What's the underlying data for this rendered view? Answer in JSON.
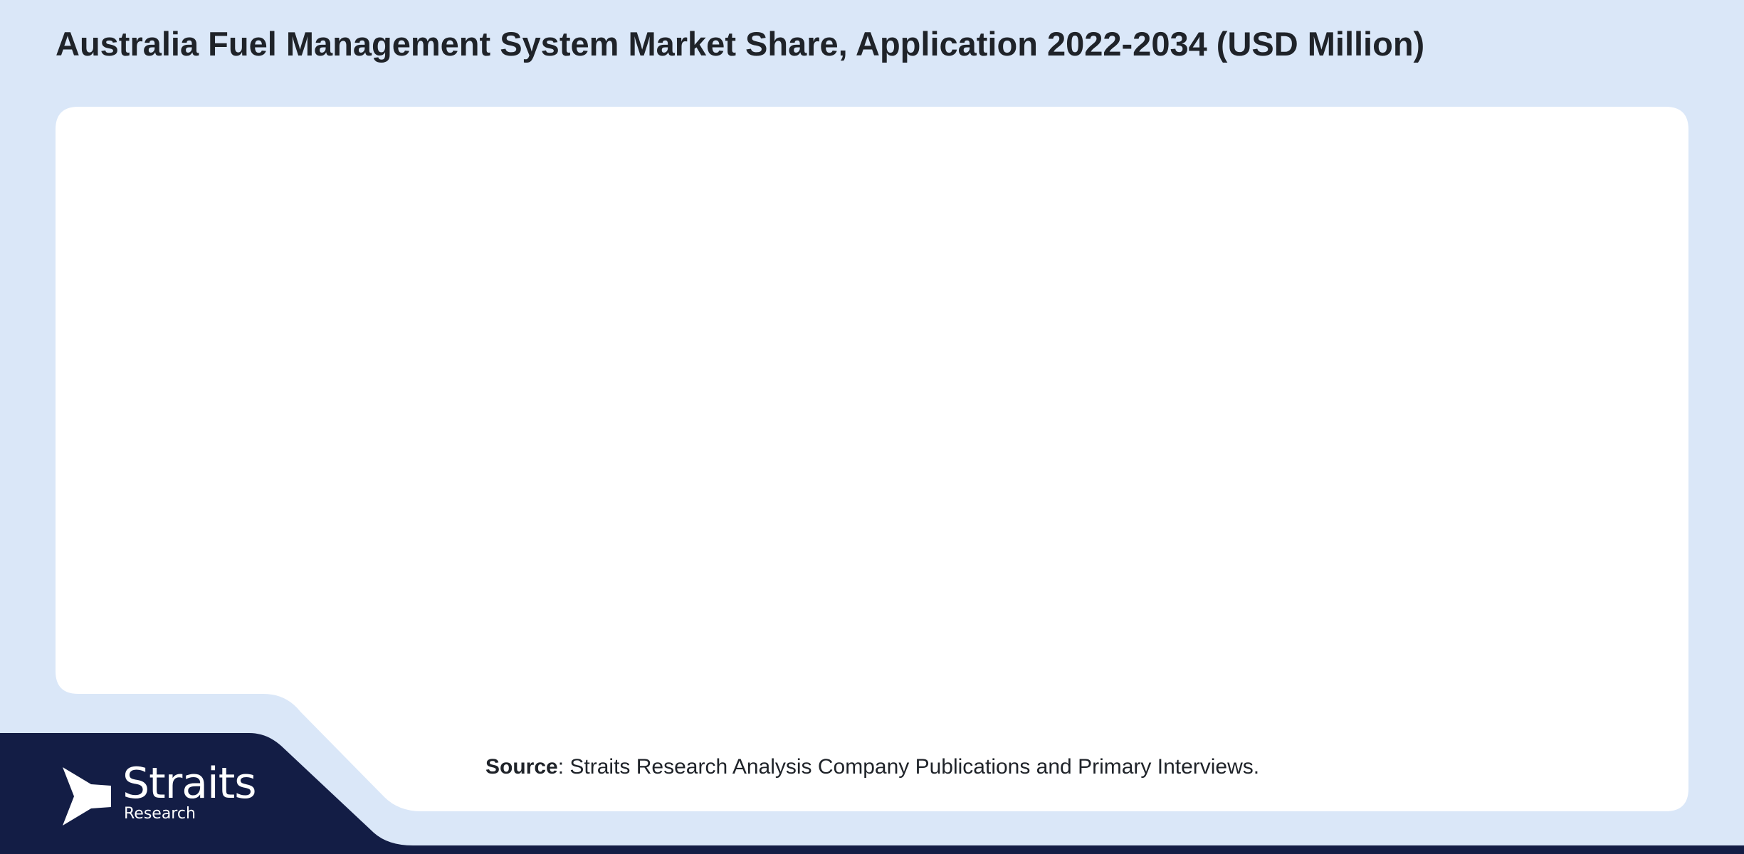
{
  "header": {
    "title": "Australia Fuel Management System Market Share, Application 2022-2034 (USD Million)"
  },
  "footer": {
    "source_label": "Source",
    "source_text": ": Straits Research Analysis Company Publications and Primary Interviews."
  },
  "logo": {
    "name": "Straits",
    "sub": "Research"
  },
  "colors": {
    "page_background": "#dae7f8",
    "panel_background": "#ffffff",
    "navy": "#131d45",
    "title_text": "#1f2329"
  },
  "icons": {
    "logo_mark": "arrow-flag-icon"
  },
  "chart_data": {
    "type": "bar",
    "title": "Australia Fuel Management System Market Share, Application 2022-2034 (USD Million)",
    "categories": [],
    "series": [],
    "xlabel": "",
    "ylabel": "",
    "note": ""
  }
}
